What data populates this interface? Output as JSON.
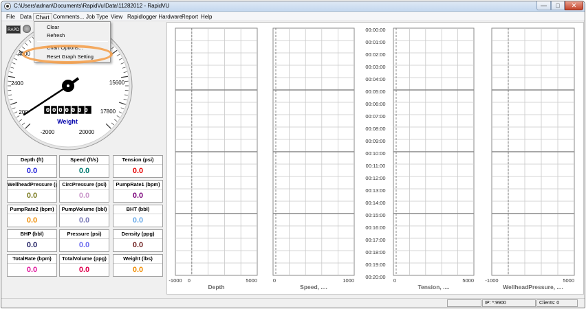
{
  "window": {
    "title": "C:\\Users\\adnan\\Documents\\RapidVu\\Data\\11282012 - RapidVU",
    "controls": {
      "minimize": "—",
      "maximize": "□",
      "close": "✕"
    }
  },
  "menu": [
    "File",
    "Data",
    "Chart",
    "Comments...",
    "Job Type",
    "View",
    "Rapidlogger Hardware",
    "Report",
    "Help"
  ],
  "chart_menu": {
    "items": [
      "Clear",
      "Refresh",
      "Chart Options...",
      "Reset Graph Setting"
    ],
    "highlighted": "Reset Graph Setting"
  },
  "gauge": {
    "button": "RAPD",
    "label": "Weight",
    "odometer": "0000000",
    "scale_labels": [
      "4000",
      "2400",
      "200",
      "-2000",
      "20000",
      "17800",
      "15600"
    ],
    "accent_color": "#0000aa"
  },
  "readings": [
    {
      "label": "Depth (ft)",
      "value": "0.0",
      "color": "#1a1adc"
    },
    {
      "label": "Speed (ft/s)",
      "value": "0.0",
      "color": "#007a70"
    },
    {
      "label": "Tension (psi)",
      "value": "0.0",
      "color": "#e60000"
    },
    {
      "label": "WellheadPressure (psi)",
      "value": "0.0",
      "color": "#7a7a1e"
    },
    {
      "label": "CircPressure (psi)",
      "value": "0.0",
      "color": "#cc99cc"
    },
    {
      "label": "PumpRate1 (bpm)",
      "value": "0.0",
      "color": "#7a007a"
    },
    {
      "label": "PumpRate2 (bpm)",
      "value": "0.0",
      "color": "#f08c00"
    },
    {
      "label": "PumpVolume (bbl)",
      "value": "0.0",
      "color": "#7a7ab8"
    },
    {
      "label": "BHT (bbl)",
      "value": "0.0",
      "color": "#66a8e8"
    },
    {
      "label": "BHP (bbl)",
      "value": "0.0",
      "color": "#1a1a5e"
    },
    {
      "label": "Pressure (psi)",
      "value": "0.0",
      "color": "#6b6bf0"
    },
    {
      "label": "Density (ppg)",
      "value": "0.0",
      "color": "#6e1e1e"
    },
    {
      "label": "TotalRate (bpm)",
      "value": "0.0",
      "color": "#e0149c"
    },
    {
      "label": "TotalVolume (ppg)",
      "value": "0.0",
      "color": "#e0004e"
    },
    {
      "label": "Weight (lbs)",
      "value": "0.0",
      "color": "#f08c00"
    }
  ],
  "status_bar": {
    "ip": "IP: *:9900",
    "clients": "Clients: 0"
  },
  "chart_data": {
    "type": "line",
    "time_axis": [
      "00:00:00",
      "00:01:00",
      "00:02:00",
      "00:03:00",
      "00:04:00",
      "00:05:00",
      "00:06:00",
      "00:07:00",
      "00:08:00",
      "00:09:00",
      "00:10:00",
      "00:11:00",
      "00:12:00",
      "00:13:00",
      "00:14:00",
      "00:15:00",
      "00:16:00",
      "00:17:00",
      "00:18:00",
      "00:19:00",
      "00:20:00"
    ],
    "tracks": [
      {
        "xlabel": "Depth",
        "xlim": [
          -1000,
          5000
        ],
        "ticks": [
          "-1000",
          "0",
          "5000"
        ],
        "series": []
      },
      {
        "xlabel": "Speed, ....",
        "xlim": [
          0,
          1000
        ],
        "ticks": [
          "0",
          "1000"
        ],
        "series": []
      },
      {
        "xlabel": "Tension, ....",
        "xlim": [
          0,
          5000
        ],
        "ticks": [
          "0",
          "5000"
        ],
        "series": []
      },
      {
        "xlabel": "WellheadPressure, ....",
        "xlim": [
          -1000,
          5000
        ],
        "ticks": [
          "-1000",
          "5000"
        ],
        "series": []
      }
    ],
    "grid": true,
    "grid_color": "#c8c8c8",
    "major_grid_color": "#8a8a8a"
  }
}
